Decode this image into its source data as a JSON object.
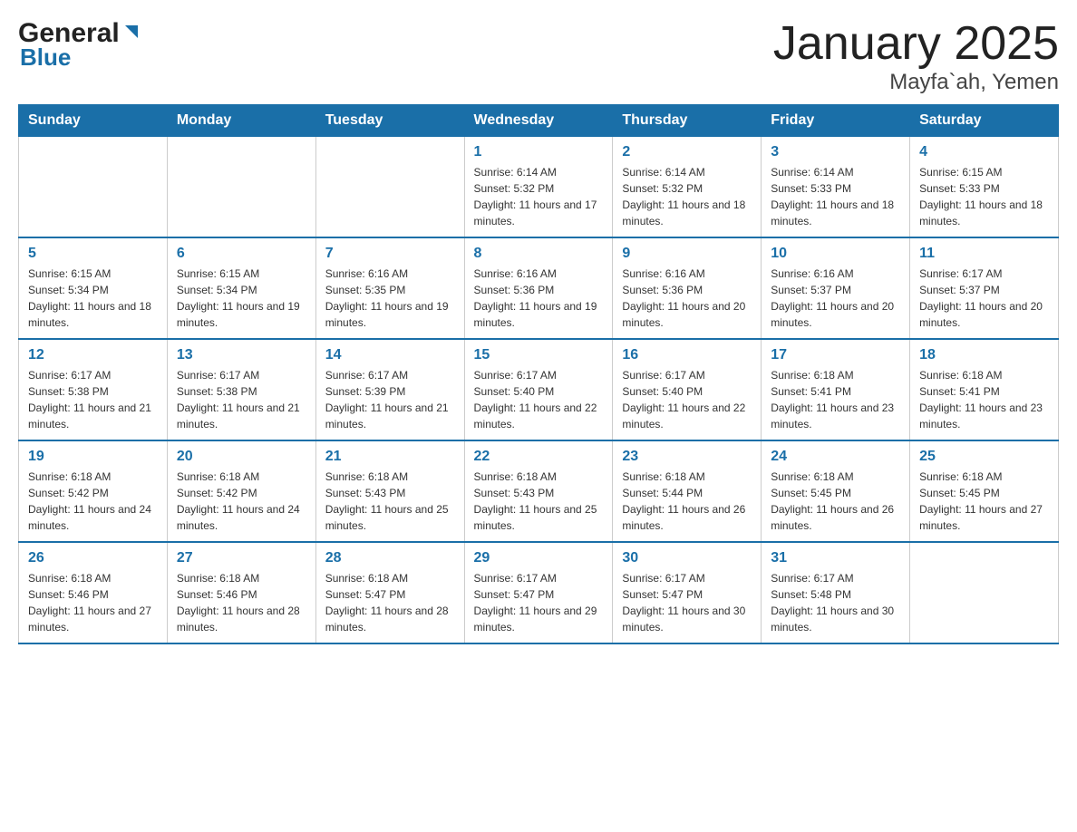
{
  "logo": {
    "general": "General",
    "blue": "Blue"
  },
  "title": "January 2025",
  "subtitle": "Mayfa`ah, Yemen",
  "header_days": [
    "Sunday",
    "Monday",
    "Tuesday",
    "Wednesday",
    "Thursday",
    "Friday",
    "Saturday"
  ],
  "weeks": [
    [
      {
        "num": "",
        "info": ""
      },
      {
        "num": "",
        "info": ""
      },
      {
        "num": "",
        "info": ""
      },
      {
        "num": "1",
        "info": "Sunrise: 6:14 AM\nSunset: 5:32 PM\nDaylight: 11 hours and 17 minutes."
      },
      {
        "num": "2",
        "info": "Sunrise: 6:14 AM\nSunset: 5:32 PM\nDaylight: 11 hours and 18 minutes."
      },
      {
        "num": "3",
        "info": "Sunrise: 6:14 AM\nSunset: 5:33 PM\nDaylight: 11 hours and 18 minutes."
      },
      {
        "num": "4",
        "info": "Sunrise: 6:15 AM\nSunset: 5:33 PM\nDaylight: 11 hours and 18 minutes."
      }
    ],
    [
      {
        "num": "5",
        "info": "Sunrise: 6:15 AM\nSunset: 5:34 PM\nDaylight: 11 hours and 18 minutes."
      },
      {
        "num": "6",
        "info": "Sunrise: 6:15 AM\nSunset: 5:34 PM\nDaylight: 11 hours and 19 minutes."
      },
      {
        "num": "7",
        "info": "Sunrise: 6:16 AM\nSunset: 5:35 PM\nDaylight: 11 hours and 19 minutes."
      },
      {
        "num": "8",
        "info": "Sunrise: 6:16 AM\nSunset: 5:36 PM\nDaylight: 11 hours and 19 minutes."
      },
      {
        "num": "9",
        "info": "Sunrise: 6:16 AM\nSunset: 5:36 PM\nDaylight: 11 hours and 20 minutes."
      },
      {
        "num": "10",
        "info": "Sunrise: 6:16 AM\nSunset: 5:37 PM\nDaylight: 11 hours and 20 minutes."
      },
      {
        "num": "11",
        "info": "Sunrise: 6:17 AM\nSunset: 5:37 PM\nDaylight: 11 hours and 20 minutes."
      }
    ],
    [
      {
        "num": "12",
        "info": "Sunrise: 6:17 AM\nSunset: 5:38 PM\nDaylight: 11 hours and 21 minutes."
      },
      {
        "num": "13",
        "info": "Sunrise: 6:17 AM\nSunset: 5:38 PM\nDaylight: 11 hours and 21 minutes."
      },
      {
        "num": "14",
        "info": "Sunrise: 6:17 AM\nSunset: 5:39 PM\nDaylight: 11 hours and 21 minutes."
      },
      {
        "num": "15",
        "info": "Sunrise: 6:17 AM\nSunset: 5:40 PM\nDaylight: 11 hours and 22 minutes."
      },
      {
        "num": "16",
        "info": "Sunrise: 6:17 AM\nSunset: 5:40 PM\nDaylight: 11 hours and 22 minutes."
      },
      {
        "num": "17",
        "info": "Sunrise: 6:18 AM\nSunset: 5:41 PM\nDaylight: 11 hours and 23 minutes."
      },
      {
        "num": "18",
        "info": "Sunrise: 6:18 AM\nSunset: 5:41 PM\nDaylight: 11 hours and 23 minutes."
      }
    ],
    [
      {
        "num": "19",
        "info": "Sunrise: 6:18 AM\nSunset: 5:42 PM\nDaylight: 11 hours and 24 minutes."
      },
      {
        "num": "20",
        "info": "Sunrise: 6:18 AM\nSunset: 5:42 PM\nDaylight: 11 hours and 24 minutes."
      },
      {
        "num": "21",
        "info": "Sunrise: 6:18 AM\nSunset: 5:43 PM\nDaylight: 11 hours and 25 minutes."
      },
      {
        "num": "22",
        "info": "Sunrise: 6:18 AM\nSunset: 5:43 PM\nDaylight: 11 hours and 25 minutes."
      },
      {
        "num": "23",
        "info": "Sunrise: 6:18 AM\nSunset: 5:44 PM\nDaylight: 11 hours and 26 minutes."
      },
      {
        "num": "24",
        "info": "Sunrise: 6:18 AM\nSunset: 5:45 PM\nDaylight: 11 hours and 26 minutes."
      },
      {
        "num": "25",
        "info": "Sunrise: 6:18 AM\nSunset: 5:45 PM\nDaylight: 11 hours and 27 minutes."
      }
    ],
    [
      {
        "num": "26",
        "info": "Sunrise: 6:18 AM\nSunset: 5:46 PM\nDaylight: 11 hours and 27 minutes."
      },
      {
        "num": "27",
        "info": "Sunrise: 6:18 AM\nSunset: 5:46 PM\nDaylight: 11 hours and 28 minutes."
      },
      {
        "num": "28",
        "info": "Sunrise: 6:18 AM\nSunset: 5:47 PM\nDaylight: 11 hours and 28 minutes."
      },
      {
        "num": "29",
        "info": "Sunrise: 6:17 AM\nSunset: 5:47 PM\nDaylight: 11 hours and 29 minutes."
      },
      {
        "num": "30",
        "info": "Sunrise: 6:17 AM\nSunset: 5:47 PM\nDaylight: 11 hours and 30 minutes."
      },
      {
        "num": "31",
        "info": "Sunrise: 6:17 AM\nSunset: 5:48 PM\nDaylight: 11 hours and 30 minutes."
      },
      {
        "num": "",
        "info": ""
      }
    ]
  ]
}
